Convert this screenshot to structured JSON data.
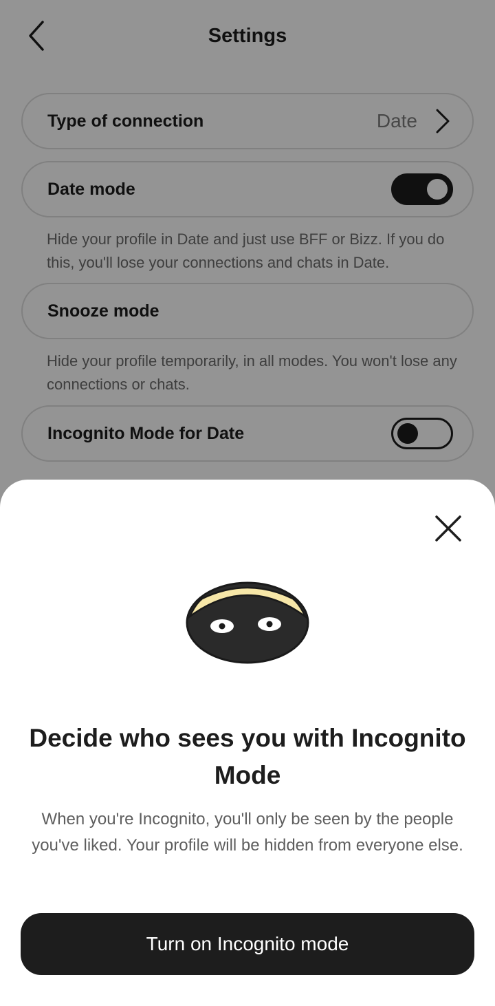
{
  "header": {
    "title": "Settings",
    "back_icon": "chevron-left-icon"
  },
  "settings": {
    "connection": {
      "label": "Type of connection",
      "value": "Date",
      "icon": "chevron-right-icon"
    },
    "date_mode": {
      "label": "Date mode",
      "enabled": true,
      "description": "Hide your profile in Date and just use BFF or Bizz. If you do this, you'll lose your connections and chats in Date."
    },
    "snooze_mode": {
      "label": "Snooze mode",
      "description": "Hide your profile temporarily, in all modes. You won't lose any connections or chats."
    },
    "incognito": {
      "label": "Incognito Mode for Date",
      "enabled": false
    }
  },
  "sheet": {
    "close_icon": "close-icon",
    "illustration": "incognito-mask-icon",
    "title": "Decide who sees you with Incognito Mode",
    "body": "When you're Incognito, you'll only be seen by the people you've liked. Your profile will be hidden from everyone else.",
    "cta_label": "Turn on Incognito mode"
  },
  "colors": {
    "primary": "#1d1d1d",
    "mask_band": "#f7e7a8",
    "overlay": "rgba(0,0,0,0.42)"
  }
}
